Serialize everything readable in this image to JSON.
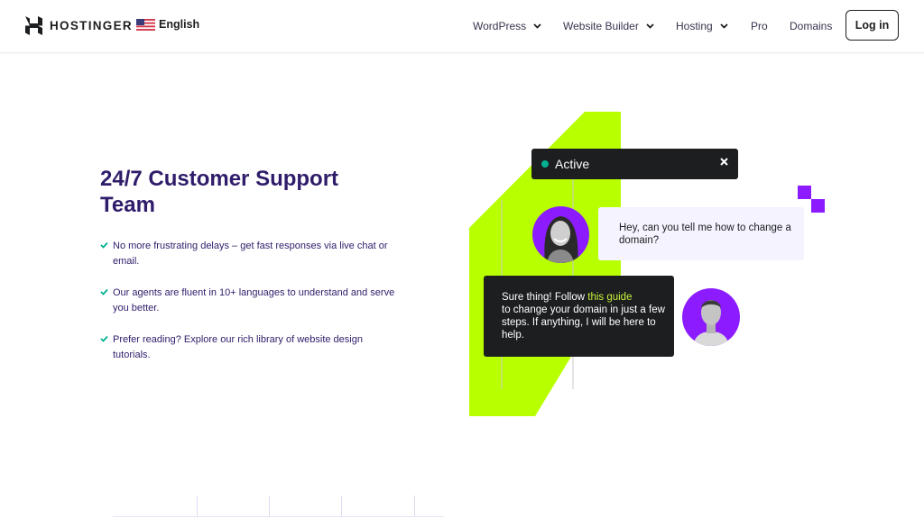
{
  "header": {
    "brand": "HOSTINGER",
    "language": {
      "label": "English",
      "flag_icon": "us-flag-icon"
    },
    "nav": [
      {
        "label": "WordPress",
        "has_dropdown": true
      },
      {
        "label": "Website Builder",
        "has_dropdown": true
      },
      {
        "label": "Hosting",
        "has_dropdown": true
      },
      {
        "label": "Pro",
        "has_dropdown": false
      },
      {
        "label": "Domains",
        "has_dropdown": false
      }
    ],
    "login_label": "Log in"
  },
  "section": {
    "title": "24/7 Customer Support Team",
    "features": [
      "No more frustrating delays – get fast responses via live chat or email.",
      "Our agents are fluent in 10+ languages to understand and serve you better.",
      "Prefer reading? Explore our rich library of website design tutorials."
    ]
  },
  "chat": {
    "status_label": "Active",
    "status_color": "#00b090",
    "user_message": "Hey, can you tell me how to change a domain?",
    "agent_message_prefix": "Sure thing! Follow ",
    "agent_message_link": "this guide",
    "agent_message_suffix": " to change your domain in just a few steps.  If anything, I will be here to help."
  },
  "colors": {
    "primary_text": "#2f1c6a",
    "accent_purple": "#8c1cff",
    "accent_lime": "#b8ff00",
    "dark": "#1d1e20",
    "check_green": "#00b090"
  }
}
